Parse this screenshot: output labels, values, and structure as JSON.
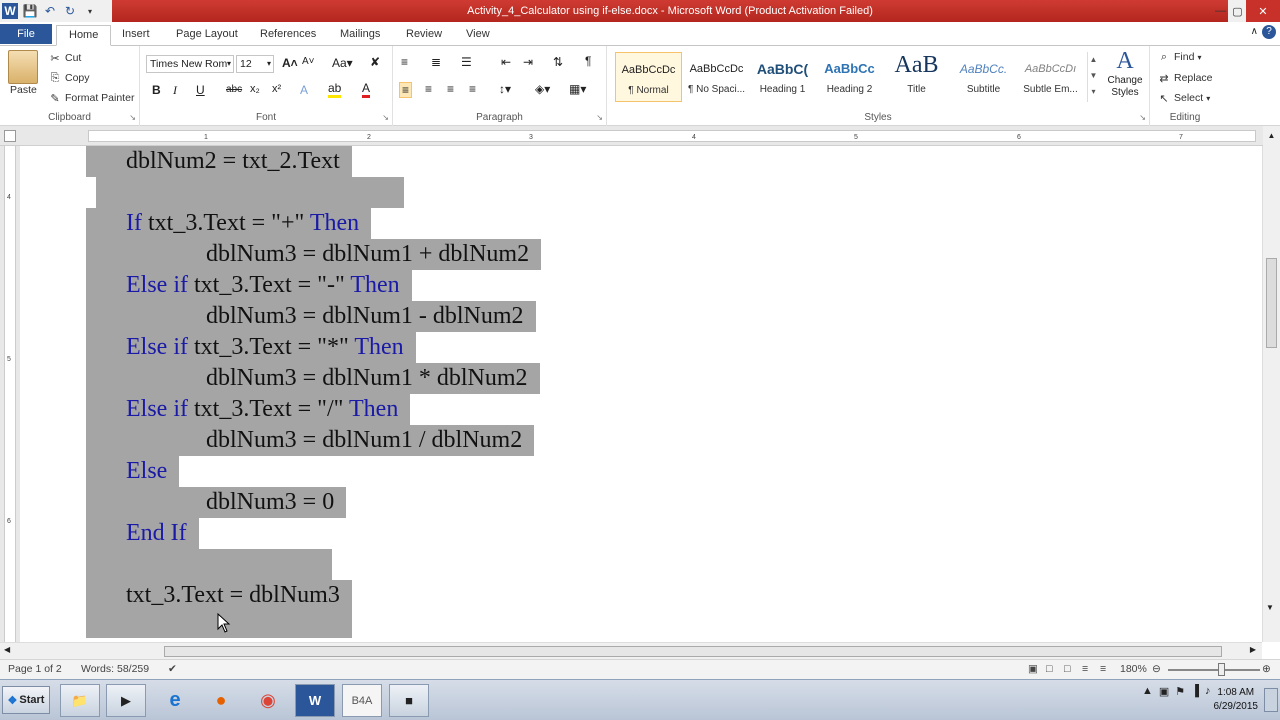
{
  "window": {
    "title": "Activity_4_Calculator using if-else.docx  -  Microsoft Word (Product Activation Failed)",
    "controls": [
      "?",
      "⬚",
      "—",
      "✕"
    ]
  },
  "qat": {
    "app_letter": "W"
  },
  "tabs": [
    {
      "label": "File"
    },
    {
      "label": "Home"
    },
    {
      "label": "Insert"
    },
    {
      "label": "Page Layout"
    },
    {
      "label": "References"
    },
    {
      "label": "Mailings"
    },
    {
      "label": "Review"
    },
    {
      "label": "View"
    }
  ],
  "clipboard": {
    "paste": "Paste",
    "cut": "Cut",
    "copy": "Copy",
    "format_painter": "Format Painter",
    "label": "Clipboard"
  },
  "font": {
    "name": "Times New Rom",
    "size": "12",
    "label": "Font",
    "bold": "B",
    "italic": "I",
    "underline": "U",
    "strike": "abc",
    "sub": "x₂",
    "sup": "x²"
  },
  "paragraph": {
    "label": "Paragraph",
    "pilcrow": "¶"
  },
  "styles": {
    "label": "Styles",
    "items": [
      {
        "sample": "AaBbCcDc",
        "name": "¶ Normal"
      },
      {
        "sample": "AaBbCcDc",
        "name": "¶ No Spaci..."
      },
      {
        "sample": "AaBbC(",
        "name": "Heading 1"
      },
      {
        "sample": "AaBbCc",
        "name": "Heading 2"
      },
      {
        "sample": "AaB",
        "name": "Title"
      },
      {
        "sample": "AaBbCc.",
        "name": "Subtitle"
      },
      {
        "sample": "AaBbCcDı",
        "name": "Subtle Em..."
      }
    ],
    "change_styles": "Change Styles"
  },
  "editing": {
    "label": "Editing",
    "find": "Find",
    "replace": "Replace",
    "select": "Select"
  },
  "ruler": {
    "ticks": [
      "1",
      "2",
      "3",
      "4",
      "5",
      "6",
      "7"
    ],
    "vticks": [
      "4",
      "5",
      "6"
    ]
  },
  "document": {
    "lines": [
      {
        "segments": [
          {
            "text": "dblNum2 = txt_2.Text",
            "kw": false
          }
        ]
      },
      {
        "segments": [
          {
            "text": "",
            "kw": false
          }
        ]
      },
      {
        "segments": [
          {
            "text": "If",
            "kw": true
          },
          {
            "text": " txt_3.Text = \"+\" ",
            "kw": false
          },
          {
            "text": "Then",
            "kw": true
          }
        ]
      },
      {
        "segments": [
          {
            "text": "dblNum3 = dblNum1 + dblNum2",
            "kw": false
          }
        ]
      },
      {
        "segments": [
          {
            "text": "Else if",
            "kw": true
          },
          {
            "text": " txt_3.Text = \"-\" ",
            "kw": false
          },
          {
            "text": "Then",
            "kw": true
          }
        ]
      },
      {
        "segments": [
          {
            "text": "dblNum3 = dblNum1 - dblNum2",
            "kw": false
          }
        ]
      },
      {
        "segments": [
          {
            "text": "Else if",
            "kw": true
          },
          {
            "text": " txt_3.Text = \"*\" ",
            "kw": false
          },
          {
            "text": "Then",
            "kw": true
          }
        ]
      },
      {
        "segments": [
          {
            "text": "dblNum3 = dblNum1 * dblNum2",
            "kw": false
          }
        ]
      },
      {
        "segments": [
          {
            "text": "Else if",
            "kw": true
          },
          {
            "text": " txt_3.Text = \"/\" ",
            "kw": false
          },
          {
            "text": "Then",
            "kw": true
          }
        ]
      },
      {
        "segments": [
          {
            "text": "dblNum3 = dblNum1 / dblNum2",
            "kw": false
          }
        ]
      },
      {
        "segments": [
          {
            "text": "Else",
            "kw": true
          }
        ]
      },
      {
        "segments": [
          {
            "text": "dblNum3 = 0",
            "kw": false
          }
        ]
      },
      {
        "segments": [
          {
            "text": "End If",
            "kw": true
          }
        ]
      },
      {
        "segments": [
          {
            "text": "",
            "kw": false
          }
        ]
      },
      {
        "segments": [
          {
            "text": "txt_3.Text = dblNum3",
            "kw": false
          }
        ]
      }
    ],
    "selection_color": "#a5a5a5",
    "keyword_color": "#1a1aa6"
  },
  "status": {
    "page": "Page 1 of 2",
    "words": "Words: 58/259",
    "zoom": "180%"
  },
  "taskbar": {
    "start": "Start",
    "apps": [
      "folder-icon",
      "media-icon",
      "ie-icon",
      "firefox-icon",
      "chrome-icon",
      "word-icon",
      "b4a-icon",
      "folder2-icon"
    ],
    "b4a_label": "B4A",
    "word_label": "W",
    "time": "1:08 AM",
    "date": "6/29/2015"
  }
}
